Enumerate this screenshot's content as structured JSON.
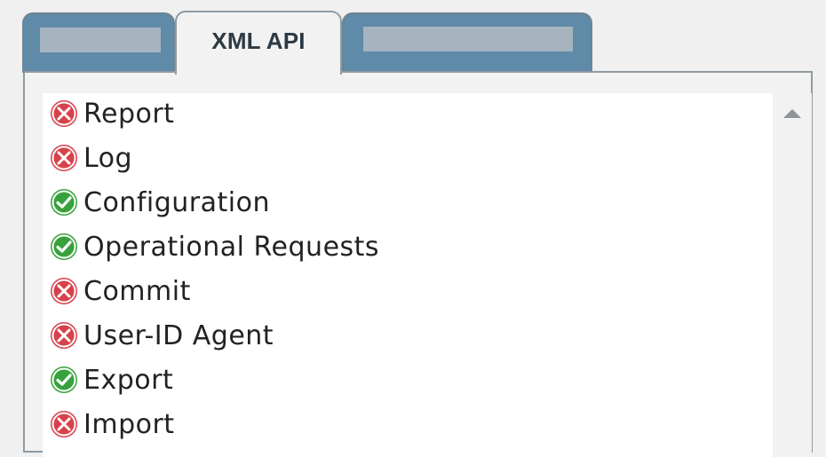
{
  "tabs": [
    {
      "label": "",
      "redacted": true
    },
    {
      "label": "XML API",
      "active": true
    },
    {
      "label": "",
      "redacted": true
    }
  ],
  "permissions": [
    {
      "label": "Report",
      "status": "disabled",
      "icon": "red-x-circle-icon"
    },
    {
      "label": "Log",
      "status": "disabled",
      "icon": "red-x-circle-icon"
    },
    {
      "label": "Configuration",
      "status": "enabled",
      "icon": "green-check-circle-icon"
    },
    {
      "label": "Operational Requests",
      "status": "enabled",
      "icon": "green-check-circle-icon"
    },
    {
      "label": "Commit",
      "status": "disabled",
      "icon": "red-x-circle-icon"
    },
    {
      "label": "User-ID Agent",
      "status": "disabled",
      "icon": "red-x-circle-icon"
    },
    {
      "label": "Export",
      "status": "enabled",
      "icon": "green-check-circle-icon"
    },
    {
      "label": "Import",
      "status": "disabled",
      "icon": "red-x-circle-icon"
    }
  ],
  "colors": {
    "enabled": "#37a23c",
    "disabled": "#d8414b",
    "tab_inactive": "#5f8aa8",
    "tab_mask": "#a6b4bf"
  }
}
